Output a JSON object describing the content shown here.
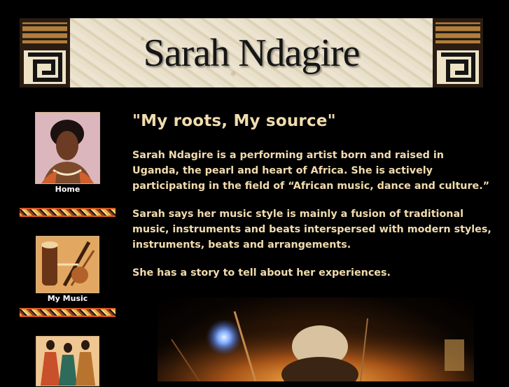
{
  "site": {
    "title": "Sarah Ndagire"
  },
  "sidebar": {
    "items": [
      {
        "label": "Home",
        "image": "portrait-photo"
      },
      {
        "label": "My Music",
        "image": "instruments-painting"
      },
      {
        "label": "",
        "image": "dancers-painting"
      }
    ]
  },
  "main": {
    "heading": "\"My roots, My source\"",
    "paragraphs": [
      "Sarah Ndagire is a performing artist born and raised in Uganda, the pearl and heart of Africa. She is actively participating in the field of “African music, dance and culture.”",
      "Sarah says her music style is mainly a fusion of traditional music, instruments and beats interspersed with modern styles, instruments, beats and arrangements.",
      "She has a story to tell about her experiences."
    ]
  },
  "colors": {
    "background": "#000000",
    "text": "#f1dcae",
    "nav_label": "#ffffff",
    "divider_accent": "#d45a24"
  }
}
